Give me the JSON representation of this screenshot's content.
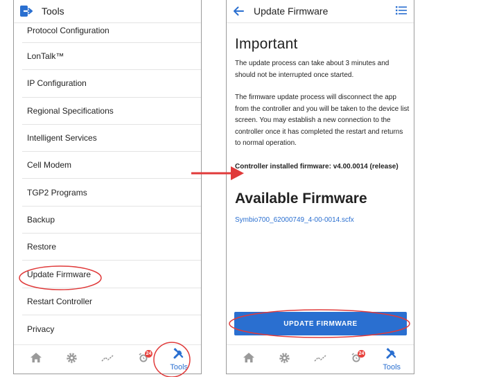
{
  "left_screen": {
    "title": "Tools",
    "menu_items": [
      "Protocol Configuration",
      "LonTalk™",
      "IP Configuration",
      "Regional Specifications",
      "Intelligent Services",
      "Cell Modem",
      "TGP2 Programs",
      "Backup",
      "Restore",
      "Update Firmware",
      "Restart Controller",
      "Privacy"
    ],
    "bottom_nav": {
      "alarm_badge": "24",
      "tools_label": "Tools"
    }
  },
  "right_screen": {
    "title": "Update Firmware",
    "important_heading": "Important",
    "paragraph_1": "The update process can take about 3 minutes and should not be interrupted once started.",
    "paragraph_2": "The firmware update process will disconnect the app from the controller and you will be taken to the device list screen. You may establish a new connection to the controller once it has completed the restart and returns to normal operation.",
    "installed_firmware": "Controller installed firmware: v4.00.0014 (release)",
    "available_heading": "Available Firmware",
    "firmware_file": "Symbio700_62000749_4-00-0014.scfx",
    "update_button": "UPDATE FIRMWARE",
    "bottom_nav": {
      "alarm_badge": "24",
      "tools_label": "Tools"
    }
  },
  "colors": {
    "accent": "#2a6fd0",
    "annotation": "#e03a3a",
    "badge": "#e8413c",
    "icon_gray": "#9a9a9a"
  },
  "icons": [
    "logout-icon",
    "back-arrow-icon",
    "list-icon",
    "home-icon",
    "gear-icon",
    "trend-icon",
    "alarm-clock-icon",
    "tools-icon"
  ]
}
